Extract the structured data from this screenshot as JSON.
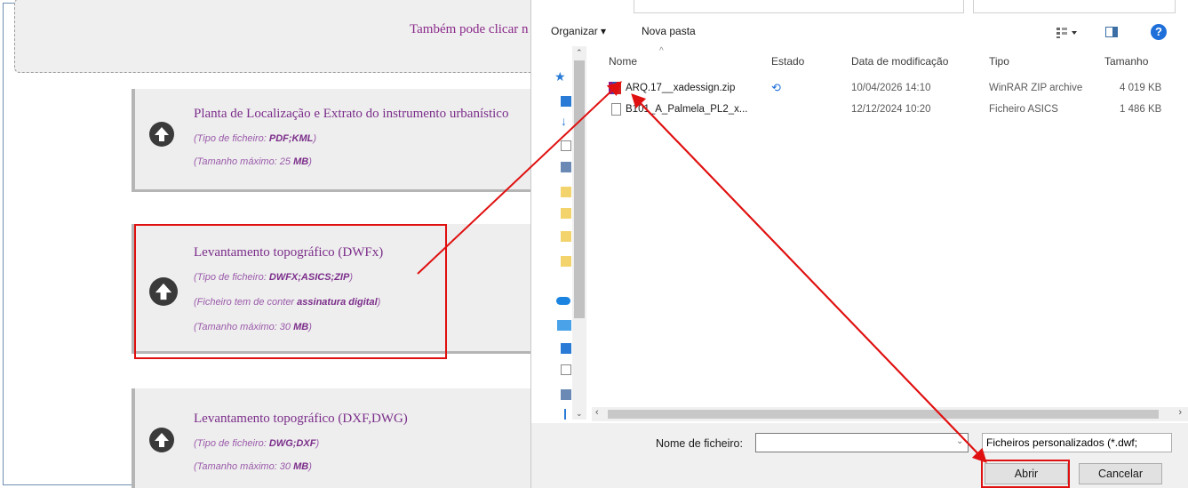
{
  "page": {
    "dropzone_text": "Também pode clicar n",
    "cards": [
      {
        "title": "Planta de Localização e Extrato do instrumento urbanístico",
        "type_label": "(Tipo de ficheiro: ",
        "type_value": "PDF;KML",
        "type_close": ")",
        "max_label": "(Tamanho máximo: 25 ",
        "max_unit": "MB",
        "max_close": ")"
      },
      {
        "title": "Levantamento topográfico (DWFx)",
        "type_label": "(Tipo de ficheiro: ",
        "type_value": "DWFX;ASICS;ZIP",
        "type_close": ")",
        "sig_label": "(Ficheiro tem de conter ",
        "sig_value": "assinatura digital",
        "sig_close": ")",
        "max_label": "(Tamanho máximo: 30 ",
        "max_unit": "MB",
        "max_close": ")"
      },
      {
        "title": "Levantamento topográfico (DXF,DWG)",
        "type_label": "(Tipo de ficheiro: ",
        "type_value": "DWG;DXF",
        "type_close": ")",
        "max_label": "(Tamanho máximo: 30 ",
        "max_unit": "MB",
        "max_close": ")"
      }
    ]
  },
  "dialog": {
    "toolbar": {
      "organize": "Organizar ▾",
      "new_folder": "Nova pasta",
      "view_icon": "view-options-icon",
      "help": "?"
    },
    "columns": {
      "name": "Nome",
      "state": "Estado",
      "modified": "Data de modificação",
      "type": "Tipo",
      "size": "Tamanho"
    },
    "files": [
      {
        "name": "ARQ.17__xadessign.zip",
        "state": "sync-icon",
        "modified": "10/04/2026 14:10",
        "type": "WinRAR ZIP archive",
        "size": "4 019 KB"
      },
      {
        "name": "B101_A_Palmela_PL2_x...",
        "state": "",
        "modified": "12/12/2024 10:20",
        "type": "Ficheiro ASICS",
        "size": "1 486 KB"
      }
    ],
    "filename_label": "Nome de ficheiro:",
    "filename_value": "",
    "filter": "Ficheiros personalizados (*.dwf;",
    "open_button": "Abrir",
    "cancel_button": "Cancelar"
  },
  "colors": {
    "annotation": "#e01010",
    "link_purple": "#7b2d8a",
    "icon_dark": "#3a3a3a"
  }
}
